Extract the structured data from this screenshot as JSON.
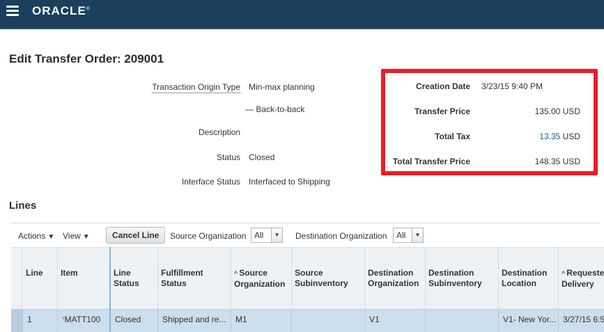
{
  "header": {
    "brand": "ORACLE"
  },
  "page": {
    "title": "Edit Transfer Order: 209001"
  },
  "details": {
    "transaction_origin_type_label": "Transaction Origin Type",
    "transaction_origin_type_value": "Min-max planning",
    "back_to_back_value": "Back-to-back",
    "description_label": "Description",
    "status_label": "Status",
    "status_value": "Closed",
    "interface_status_label": "Interface Status",
    "interface_status_value": "Interfaced to Shipping"
  },
  "pricing": {
    "creation_date_label": "Creation Date",
    "creation_date_value": "3/23/15 9:40 PM",
    "transfer_price_label": "Transfer Price",
    "transfer_price_value": "135.00 USD",
    "total_tax_label": "Total Tax",
    "total_tax_value": "13.35",
    "total_tax_currency": "USD",
    "total_transfer_price_label": "Total Transfer Price",
    "total_transfer_price_value": "148.35 USD",
    "highlight_color": "#ee1c24"
  },
  "lines": {
    "title": "Lines",
    "toolbar": {
      "actions_label": "Actions",
      "view_label": "View",
      "cancel_line_label": "Cancel Line",
      "source_org_label": "Source Organization",
      "source_org_value": "All",
      "dest_org_label": "Destination Organization",
      "dest_org_value": "All"
    },
    "columns": [
      "Line",
      "Item",
      "Line Status",
      "Fulfillment Status",
      "Source Organization",
      "Source Subinventory",
      "Destination Organization",
      "Destination Subinventory",
      "Destination Location",
      "Requested Delivery"
    ],
    "rows": [
      {
        "line": "1",
        "item": "MATT100",
        "line_status": "Closed",
        "fulfillment_status": "Shipped and re...",
        "source_org": "M1",
        "source_subinventory": "",
        "dest_org": "V1",
        "dest_subinventory": "",
        "dest_location": "V1- New Yor...",
        "requested_delivery": "3/27/15 6:5"
      }
    ]
  },
  "colors": {
    "header_bg": "#1c3f5c",
    "link": "#0a5fa8",
    "selected_row": "#ccdfee"
  }
}
